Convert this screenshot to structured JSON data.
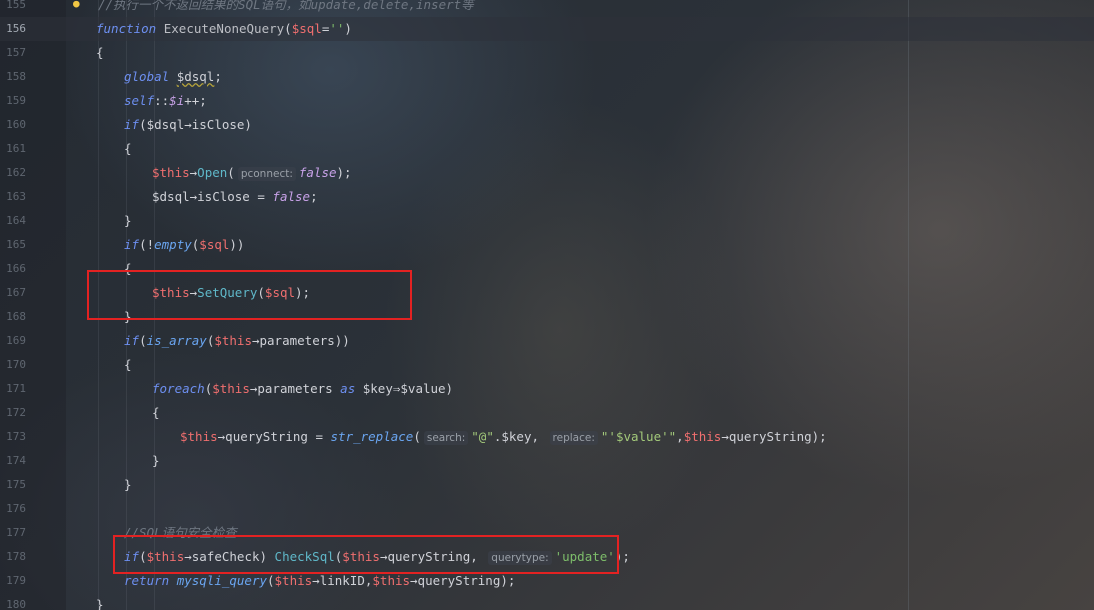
{
  "editor": {
    "lines": [
      {
        "num": "155",
        "tokens": [
          {
            "t": "//执行一个不返回结果的SQL语句，如update,delete,insert等",
            "c": "comment"
          }
        ]
      },
      {
        "num": "156",
        "tokens": [
          {
            "t": "function",
            "c": "kwb"
          },
          {
            "t": " ",
            "c": "var"
          },
          {
            "t": "ExecuteNoneQuery",
            "c": "fnname"
          },
          {
            "t": "(",
            "c": "var"
          },
          {
            "t": "$sql",
            "c": "this"
          },
          {
            "t": "=",
            "c": "var"
          },
          {
            "t": "''",
            "c": "str"
          },
          {
            "t": ")",
            "c": "var"
          }
        ]
      },
      {
        "num": "157",
        "tokens": [
          {
            "t": "{",
            "c": "var"
          }
        ]
      },
      {
        "num": "158",
        "tokens": [
          {
            "t": "global",
            "c": "kwb"
          },
          {
            "t": " ",
            "c": "var"
          },
          {
            "t": "$dsql",
            "c": "var squiggle"
          },
          {
            "t": ";",
            "c": "var"
          }
        ]
      },
      {
        "num": "159",
        "tokens": [
          {
            "t": "self",
            "c": "kwb"
          },
          {
            "t": "::",
            "c": "var"
          },
          {
            "t": "$i",
            "c": "const"
          },
          {
            "t": "++;",
            "c": "var"
          }
        ]
      },
      {
        "num": "160",
        "tokens": [
          {
            "t": "if",
            "c": "kwb"
          },
          {
            "t": "($dsql→isClose)",
            "c": "var"
          }
        ]
      },
      {
        "num": "161",
        "tokens": [
          {
            "t": "{",
            "c": "var"
          }
        ]
      },
      {
        "num": "162",
        "tokens": [
          {
            "t": "$this",
            "c": "this"
          },
          {
            "t": "→",
            "c": "var"
          },
          {
            "t": "Open",
            "c": "method"
          },
          {
            "t": "(",
            "c": "var"
          },
          {
            "t": "pconnect:",
            "c": "hint"
          },
          {
            "t": "false",
            "c": "const"
          },
          {
            "t": ");",
            "c": "var"
          }
        ]
      },
      {
        "num": "163",
        "tokens": [
          {
            "t": "$dsql→isClose = ",
            "c": "var"
          },
          {
            "t": "false",
            "c": "const"
          },
          {
            "t": ";",
            "c": "var"
          }
        ]
      },
      {
        "num": "164",
        "tokens": [
          {
            "t": "}",
            "c": "var"
          }
        ]
      },
      {
        "num": "165",
        "tokens": [
          {
            "t": "if",
            "c": "kwb"
          },
          {
            "t": "(!",
            "c": "var"
          },
          {
            "t": "empty",
            "c": "builtin"
          },
          {
            "t": "(",
            "c": "var"
          },
          {
            "t": "$sql",
            "c": "this"
          },
          {
            "t": "))",
            "c": "var"
          }
        ]
      },
      {
        "num": "166",
        "tokens": [
          {
            "t": "{",
            "c": "var"
          }
        ]
      },
      {
        "num": "167",
        "tokens": [
          {
            "t": "$this",
            "c": "this"
          },
          {
            "t": "→",
            "c": "var"
          },
          {
            "t": "SetQuery",
            "c": "method"
          },
          {
            "t": "(",
            "c": "var"
          },
          {
            "t": "$sql",
            "c": "this"
          },
          {
            "t": ");",
            "c": "var"
          }
        ]
      },
      {
        "num": "168",
        "tokens": [
          {
            "t": "}",
            "c": "var"
          }
        ]
      },
      {
        "num": "169",
        "tokens": [
          {
            "t": "if",
            "c": "kwb"
          },
          {
            "t": "(",
            "c": "var"
          },
          {
            "t": "is_array",
            "c": "builtin"
          },
          {
            "t": "(",
            "c": "var"
          },
          {
            "t": "$this",
            "c": "this"
          },
          {
            "t": "→parameters))",
            "c": "var"
          }
        ]
      },
      {
        "num": "170",
        "tokens": [
          {
            "t": "{",
            "c": "var"
          }
        ]
      },
      {
        "num": "171",
        "tokens": [
          {
            "t": "foreach",
            "c": "kwb"
          },
          {
            "t": "(",
            "c": "var"
          },
          {
            "t": "$this",
            "c": "this"
          },
          {
            "t": "→parameters ",
            "c": "var"
          },
          {
            "t": "as",
            "c": "kwb"
          },
          {
            "t": " $key⇒$value)",
            "c": "var"
          }
        ]
      },
      {
        "num": "172",
        "tokens": [
          {
            "t": "{",
            "c": "var"
          }
        ]
      },
      {
        "num": "173",
        "tokens": [
          {
            "t": "$this",
            "c": "this"
          },
          {
            "t": "→queryString = ",
            "c": "var"
          },
          {
            "t": "str_replace",
            "c": "builtin"
          },
          {
            "t": "(",
            "c": "var"
          },
          {
            "t": "search:",
            "c": "hint"
          },
          {
            "t": "\"@\"",
            "c": "strd"
          },
          {
            "t": ".$key, ",
            "c": "var"
          },
          {
            "t": "replace:",
            "c": "hint"
          },
          {
            "t": "\"'$value'\"",
            "c": "strd"
          },
          {
            "t": ",",
            "c": "var"
          },
          {
            "t": "$this",
            "c": "this"
          },
          {
            "t": "→queryString);",
            "c": "var"
          }
        ]
      },
      {
        "num": "174",
        "tokens": [
          {
            "t": "}",
            "c": "var"
          }
        ]
      },
      {
        "num": "175",
        "tokens": [
          {
            "t": "}",
            "c": "var"
          }
        ]
      },
      {
        "num": "176",
        "tokens": []
      },
      {
        "num": "177",
        "tokens": [
          {
            "t": "//SQL语句安全检查",
            "c": "comment"
          }
        ]
      },
      {
        "num": "178",
        "tokens": [
          {
            "t": "if",
            "c": "kwb"
          },
          {
            "t": "(",
            "c": "var"
          },
          {
            "t": "$this",
            "c": "this"
          },
          {
            "t": "→safeCheck) ",
            "c": "var"
          },
          {
            "t": "CheckSql",
            "c": "method"
          },
          {
            "t": "(",
            "c": "var"
          },
          {
            "t": "$this",
            "c": "this"
          },
          {
            "t": "→queryString, ",
            "c": "var"
          },
          {
            "t": "querytype:",
            "c": "hint"
          },
          {
            "t": "'update'",
            "c": "str"
          },
          {
            "t": ");",
            "c": "var"
          }
        ]
      },
      {
        "num": "179",
        "tokens": [
          {
            "t": "return",
            "c": "kwb"
          },
          {
            "t": " ",
            "c": "var"
          },
          {
            "t": "mysqli_query",
            "c": "builtin"
          },
          {
            "t": "(",
            "c": "var"
          },
          {
            "t": "$this",
            "c": "this"
          },
          {
            "t": "→linkID,",
            "c": "var"
          },
          {
            "t": "$this",
            "c": "this"
          },
          {
            "t": "→queryString);",
            "c": "var"
          }
        ]
      },
      {
        "num": "180",
        "tokens": [
          {
            "t": "}",
            "c": "var"
          }
        ]
      }
    ]
  }
}
